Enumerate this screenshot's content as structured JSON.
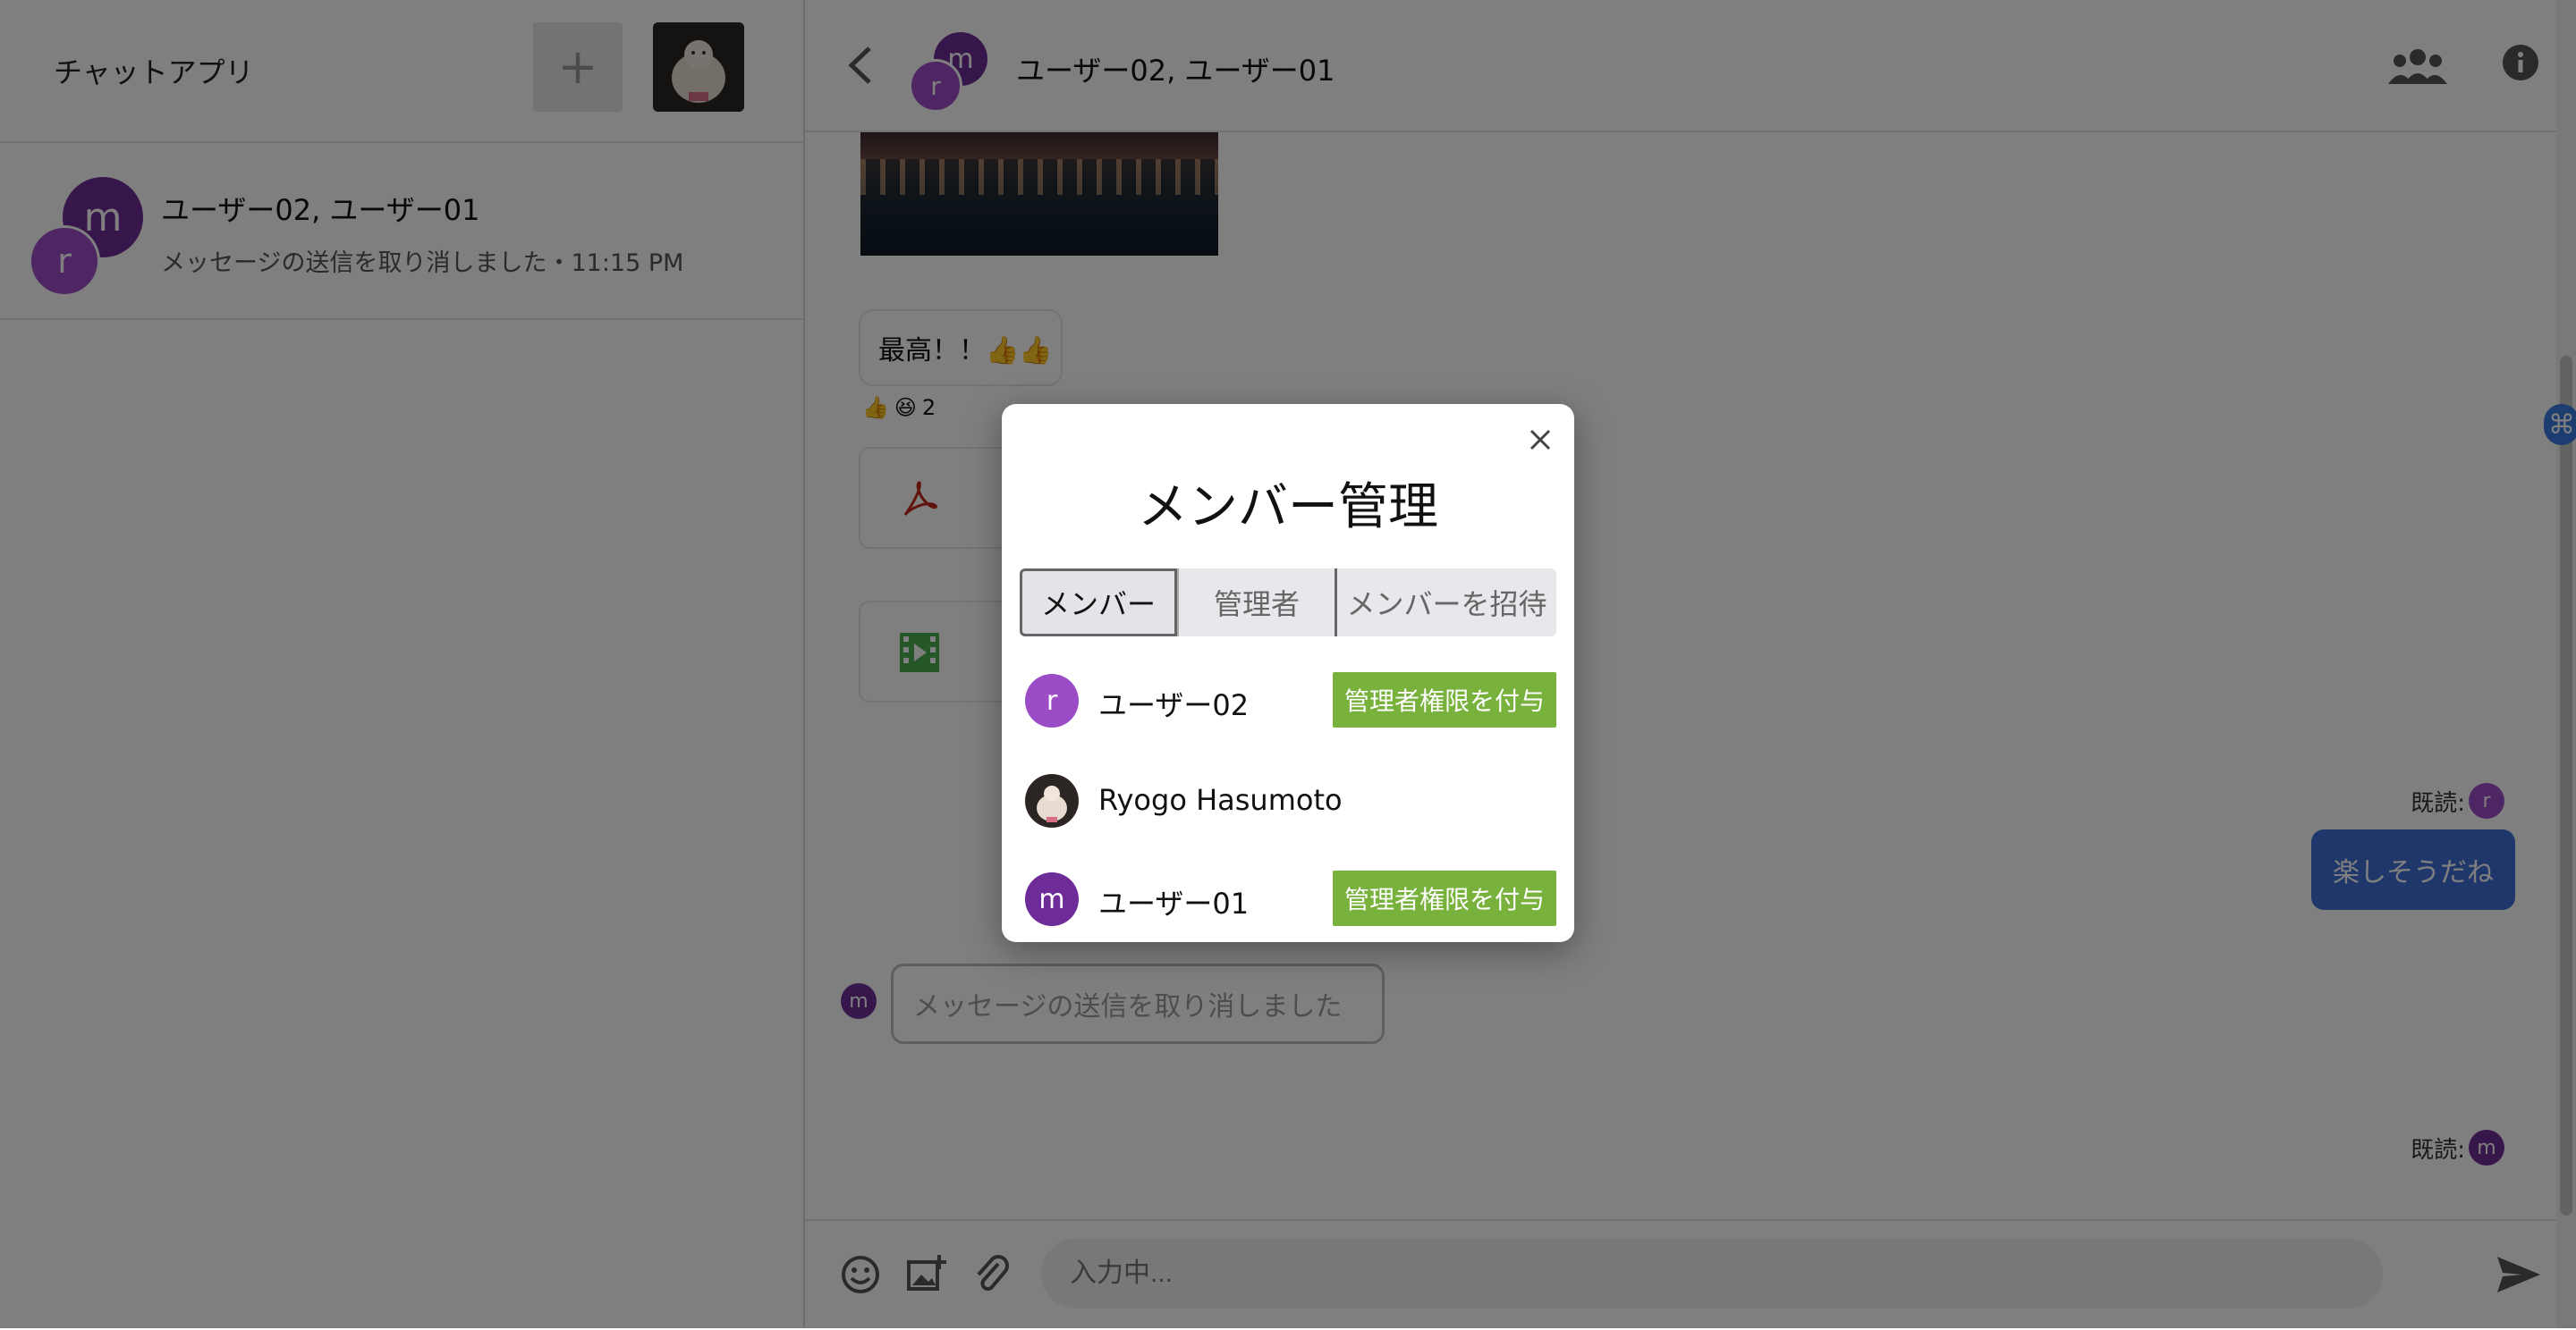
{
  "sidebar": {
    "app_title": "チャットアプリ",
    "add_label": "+",
    "conversations": [
      {
        "avatar_primary": "m",
        "avatar_secondary": "r",
        "name": "ユーザー02, ユーザー01",
        "last_message": "メッセージの送信を取り消しました・11:15 PM"
      }
    ]
  },
  "chat": {
    "title": "ユーザー02, ユーザー01",
    "avatar_primary": "m",
    "avatar_secondary": "r",
    "messages": {
      "incoming_text": "最高！！👍👍",
      "reaction_count": "2",
      "read_label_1": "既読:",
      "read_avatar_1": "r",
      "outgoing_text": "楽しそうだね",
      "recall_avatar": "m",
      "recalled_text": "メッセージの送信を取り消しました",
      "read_label_2": "既読:",
      "read_avatar_2": "m"
    },
    "composer": {
      "placeholder": "入力中..."
    }
  },
  "modal": {
    "title": "メンバー管理",
    "tabs": [
      "メンバー",
      "管理者",
      "メンバーを招待"
    ],
    "active_tab": "メンバー",
    "members": [
      {
        "avatar": "r",
        "name": "ユーザー02",
        "action": "管理者権限を付与"
      },
      {
        "avatar": "",
        "name": "Ryogo Hasumoto",
        "action": ""
      },
      {
        "avatar": "m",
        "name": "ユーザー01",
        "action": "管理者権限を付与"
      }
    ]
  },
  "colors": {
    "purple_dark": "#6e2c99",
    "purple_light": "#9c4dc6",
    "grant_green": "#78b23d",
    "outgoing_blue": "#3f6fd6",
    "overlay": "rgba(0,0,0,0.5)"
  },
  "icons": {
    "header_back": "chevron-left-icon",
    "header_group": "group-icon",
    "header_info": "info-icon",
    "composer": [
      "emoji-icon",
      "image-add-icon",
      "attach-icon",
      "send-icon"
    ],
    "file_pdf": "pdf-icon",
    "file_video": "video-icon",
    "modal_close": "close-icon"
  }
}
